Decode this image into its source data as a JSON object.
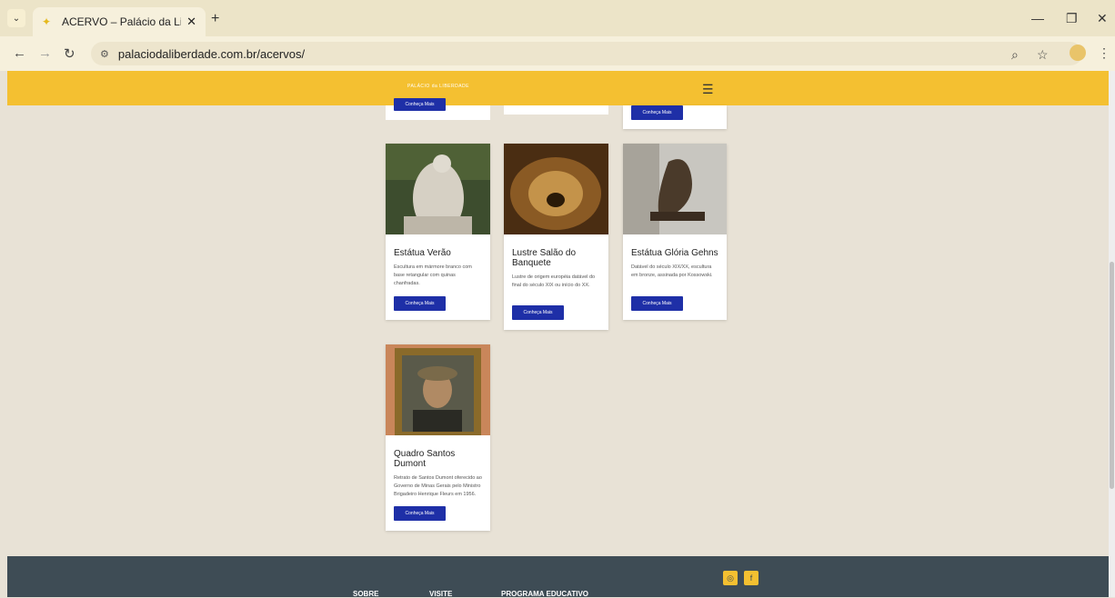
{
  "browser": {
    "tab_title": "ACERVO – Palácio da Liberdade",
    "tab_close": "✕",
    "new_tab": "+",
    "url": "palaciodaliberdade.com.br/acervos/"
  },
  "header": {
    "logo_text": "PALÁCIO da LIBERDADE"
  },
  "top_cards": {
    "left_button": "Conheça Mais",
    "right_button": "Conheça Mais"
  },
  "cards": [
    {
      "title": "Estátua Verão",
      "description": "Escultura em mármore branco com base retangular com quinas chanfradas.",
      "button": "Conheça Mais"
    },
    {
      "title": "Lustre Salão do Banquete",
      "description": "Lustre de origem européia datável do final do século XIX ou início do XX.",
      "button": "Conheça Mais"
    },
    {
      "title": "Estátua Glória Gehns",
      "description": "Datável do século XIX/XX, escultura em bronze, assinada por Kossowski.",
      "button": "Conheça Mais"
    },
    {
      "title": "Quadro Santos Dumont",
      "description": "Retrato de Santos Dumont oferecido ao Governo de Minas Gerais pelo Ministro Brigadeiro Henrique Fleurs em 1956.",
      "button": "Conheça Mais"
    }
  ],
  "footer": {
    "links": [
      "SOBRE",
      "VISITE",
      "PROGRAMA EDUCATIVO"
    ]
  },
  "colors": {
    "header_yellow": "#f4c031",
    "button_blue": "#1e2fa7",
    "footer_dark": "#3e4c55"
  }
}
